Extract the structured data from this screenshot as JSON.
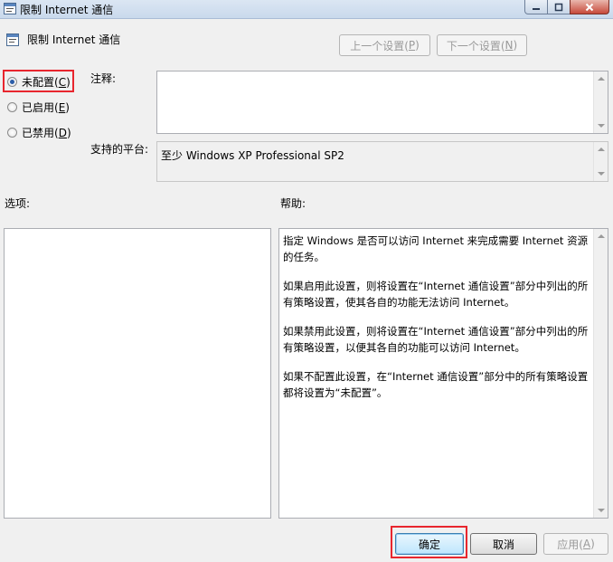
{
  "window": {
    "title": "限制 Internet 通信"
  },
  "header": {
    "title": "限制 Internet 通信",
    "prev_label": "上一个设置(",
    "prev_mnemonic": "P",
    "next_label": "下一个设置(",
    "next_mnemonic": "N"
  },
  "state": {
    "options": [
      {
        "label": "未配置(",
        "mnemonic": "C",
        "checked": true
      },
      {
        "label": "已启用(",
        "mnemonic": "E",
        "checked": false
      },
      {
        "label": "已禁用(",
        "mnemonic": "D",
        "checked": false
      }
    ]
  },
  "comment": {
    "label": "注释:",
    "value": ""
  },
  "platform": {
    "label": "支持的平台:",
    "value": "至少 Windows XP Professional SP2"
  },
  "options_section": {
    "label": "选项:"
  },
  "help_section": {
    "label": "帮助:",
    "paragraphs": [
      "指定 Windows 是否可以访问 Internet 来完成需要 Internet 资源的任务。",
      "如果启用此设置，则将设置在“Internet 通信设置”部分中列出的所有策略设置，使其各自的功能无法访问 Internet。",
      "如果禁用此设置，则将设置在“Internet 通信设置”部分中列出的所有策略设置，以便其各自的功能可以访问 Internet。",
      "如果不配置此设置，在“Internet 通信设置”部分中的所有策略设置都将设置为“未配置”。"
    ]
  },
  "footer": {
    "ok_label": "确定",
    "cancel_label": "取消",
    "apply_label": "应用(",
    "apply_mnemonic": "A"
  },
  "colors": {
    "highlight_box": "#e8262e",
    "radio_dot": "#2b5da8"
  }
}
